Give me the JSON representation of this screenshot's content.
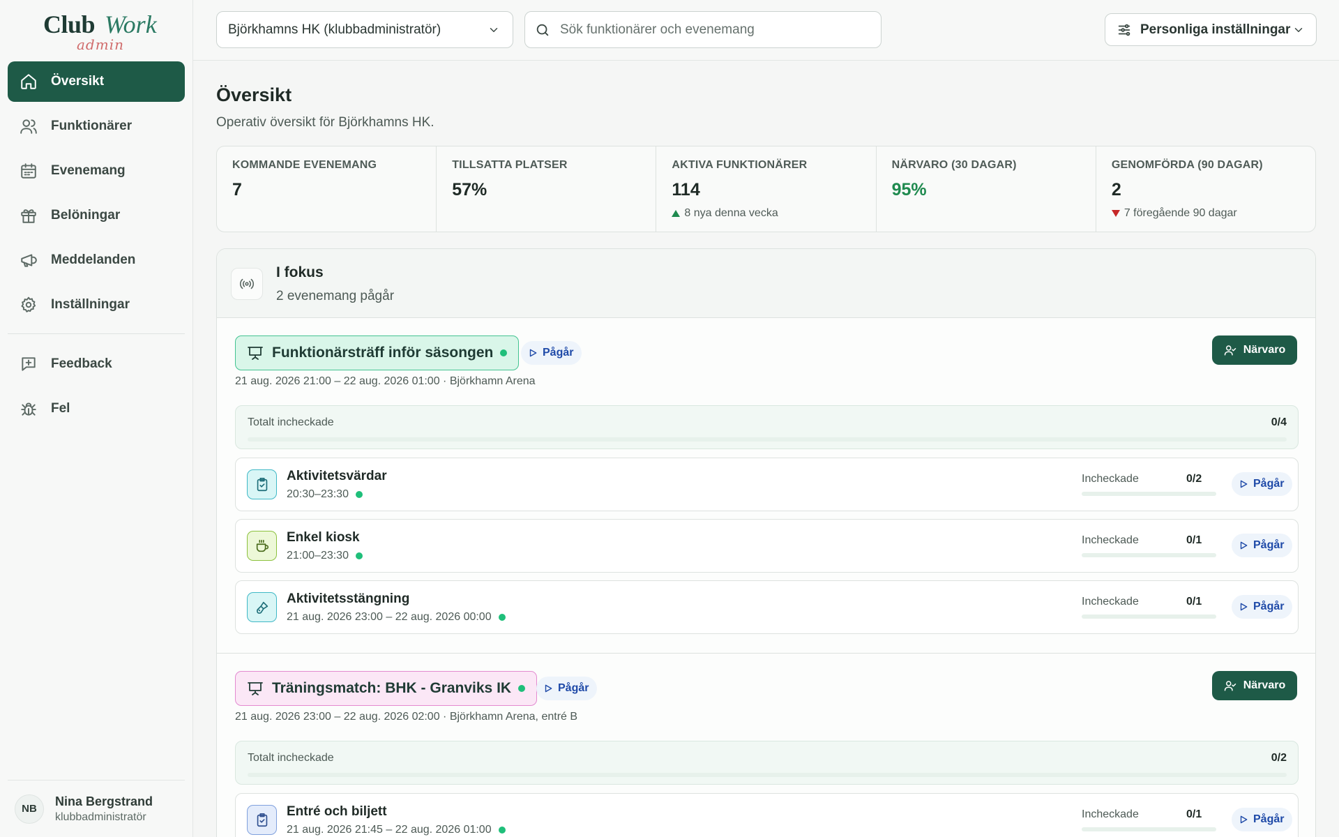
{
  "logo": {
    "club": "Club",
    "work": "Work",
    "admin": "admin"
  },
  "sidebar": {
    "items": [
      {
        "label": "Översikt",
        "icon": "home-icon",
        "active": true
      },
      {
        "label": "Funktionärer",
        "icon": "users-icon"
      },
      {
        "label": "Evenemang",
        "icon": "calendar-icon"
      },
      {
        "label": "Belöningar",
        "icon": "gift-icon"
      },
      {
        "label": "Meddelanden",
        "icon": "megaphone-icon"
      },
      {
        "label": "Inställningar",
        "icon": "gear-icon"
      }
    ],
    "secondary": [
      {
        "label": "Feedback",
        "icon": "feedback-icon"
      },
      {
        "label": "Fel",
        "icon": "bug-icon"
      }
    ],
    "user": {
      "initials": "NB",
      "name": "Nina Bergstrand",
      "role": "klubbadministratör"
    }
  },
  "header": {
    "club_select": "Björkhamns HK (klubbadministratör)",
    "search_placeholder": "Sök funktionärer och evenemang",
    "settings_label": "Personliga inställningar"
  },
  "page": {
    "title": "Översikt",
    "subtitle": "Operativ översikt för Björkhamns HK."
  },
  "stats": [
    {
      "label": "KOMMANDE EVENEMANG",
      "value": "7"
    },
    {
      "label": "TILLSATTA PLATSER",
      "value": "57%"
    },
    {
      "label": "AKTIVA FUNKTIONÄRER",
      "value": "114",
      "delta": "8 nya denna vecka",
      "trend": "up"
    },
    {
      "label": "NÄRVARO (30 DAGAR)",
      "value": "95%",
      "value_color": "#1f8a4f"
    },
    {
      "label": "GENOMFÖRDA (90 DAGAR)",
      "value": "2",
      "delta": "7 föregående 90 dagar",
      "trend": "down"
    }
  ],
  "focus": {
    "title": "I fokus",
    "subtitle": "2 evenemang pågår",
    "events": [
      {
        "name": "Funktionärsträff inför säsongen",
        "status": "Pågår",
        "narvaro_label": "Närvaro",
        "meta": "21 aug. 2026 21:00 – 22 aug. 2026 01:00 · Björkhamn Arena",
        "total_label": "Totalt incheckade",
        "total_value": "0/4",
        "roles": [
          {
            "name": "Aktivitetsvärdar",
            "time": "20:30–23:30",
            "checked_label": "Incheckade",
            "checked": "0/2",
            "status": "Pågår",
            "icon": "clipboard-check-icon"
          },
          {
            "name": "Enkel kiosk",
            "time": "21:00–23:30",
            "checked_label": "Incheckade",
            "checked": "0/1",
            "status": "Pågår",
            "icon": "coffee-icon"
          },
          {
            "name": "Aktivitetsstängning",
            "time": "21 aug. 2026 23:00 – 22 aug. 2026 00:00",
            "checked_label": "Incheckade",
            "checked": "0/1",
            "status": "Pågår",
            "icon": "brush-icon"
          }
        ]
      },
      {
        "name": "Träningsmatch: BHK - Granviks IK",
        "status": "Pågår",
        "narvaro_label": "Närvaro",
        "meta": "21 aug. 2026 23:00 – 22 aug. 2026 02:00 · Björkhamn Arena, entré B",
        "total_label": "Totalt incheckade",
        "total_value": "0/2",
        "roles": [
          {
            "name": "Entré och biljett",
            "time": "21 aug. 2026 21:45 – 22 aug. 2026 01:00",
            "checked_label": "Incheckade",
            "checked": "0/1",
            "status": "Pågår",
            "icon": "clipboard-check-icon"
          }
        ]
      }
    ]
  }
}
